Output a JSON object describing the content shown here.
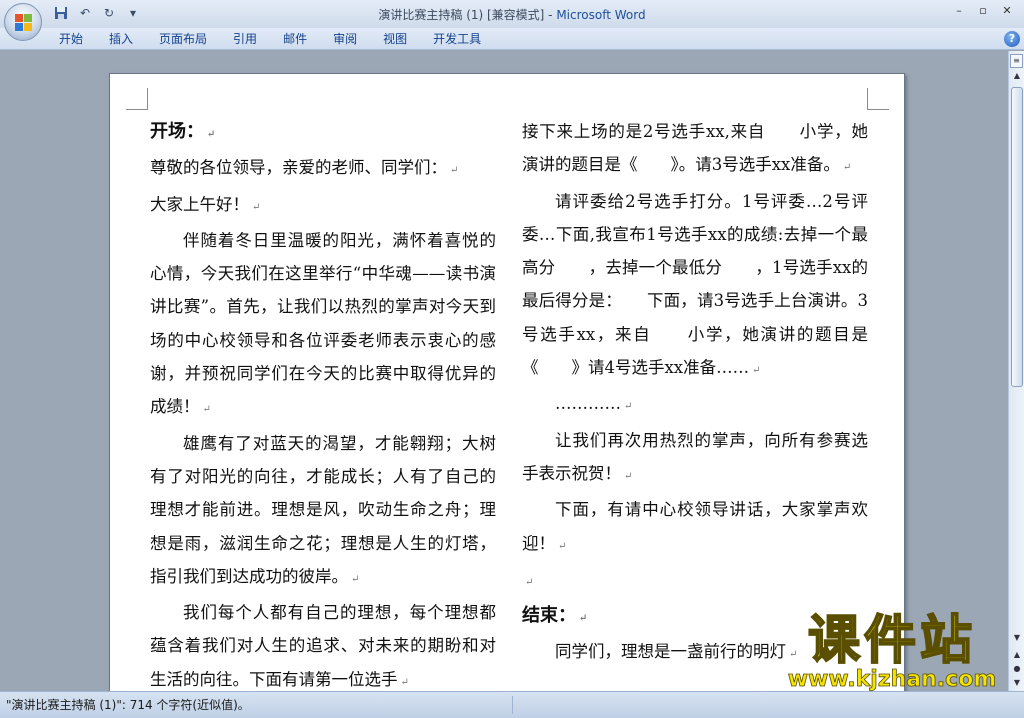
{
  "window": {
    "title_doc": "演讲比赛主持稿 (1) [兼容模式] - ",
    "title_app": "Microsoft Word"
  },
  "quick_access": {
    "save_icon": "save-icon",
    "undo_icon": "undo-icon",
    "redo_icon": "redo-icon",
    "customize_icon": "dropdown-icon"
  },
  "window_controls": {
    "minimize": "–",
    "restore": "▫",
    "close": "✕"
  },
  "ribbon": {
    "tabs": [
      "开始",
      "插入",
      "页面布局",
      "引用",
      "邮件",
      "审阅",
      "视图",
      "开发工具"
    ],
    "help": "?"
  },
  "document": {
    "left_column": [
      {
        "style": "head",
        "text": "开场："
      },
      {
        "style": "plain",
        "text": "尊敬的各位领导，亲爱的老师、同学们："
      },
      {
        "style": "plain",
        "text": "大家上午好！"
      },
      {
        "style": "indent",
        "text": "伴随着冬日里温暖的阳光，满怀着喜悦的心情，今天我们在这里举行“中华魂——读书演讲比赛”。首先，让我们以热烈的掌声对今天到场的中心校领导和各位评委老师表示衷心的感谢，并预祝同学们在今天的比赛中取得优异的成绩！"
      },
      {
        "style": "indent",
        "text": "雄鹰有了对蓝天的渴望，才能翱翔；大树有了对阳光的向往，才能成长；人有了自己的理想才能前进。理想是风，吹动生命之舟；理想是雨，滋润生命之花；理想是人生的灯塔，指引我们到达成功的彼岸。"
      },
      {
        "style": "indent",
        "text": "我们每个人都有自己的理想，每个理想都蕴含着我们对人生的追求、对未来的期盼和对生活的向往。下面有请第一位选手"
      }
    ],
    "right_column": [
      {
        "style": "plain",
        "text": "接下来上场的是2号选手xx,来自　　小学，她演讲的题目是《　　》。请3号选手xx准备。"
      },
      {
        "style": "indent",
        "text": "请评委给2号选手打分。1号评委…2号评委…下面,我宣布1号选手xx的成绩:去掉一个最高分　　，去掉一个最低分　　，1号选手xx的最后得分是：　　下面，请3号选手上台演讲。3号选手xx，来自　　小学，她演讲的题目是《　　》请4号选手xx准备……"
      },
      {
        "style": "indent",
        "text": "…………"
      },
      {
        "style": "indent",
        "text": "让我们再次用热烈的掌声，向所有参赛选手表示祝贺！"
      },
      {
        "style": "indent",
        "text": "下面，有请中心校领导讲话，大家掌声欢迎！"
      },
      {
        "style": "plain",
        "text": ""
      },
      {
        "style": "head",
        "text": "结束："
      },
      {
        "style": "indent",
        "text": "同学们，理想是一盏前行的明灯"
      }
    ]
  },
  "scrollbar": {
    "ruler_icon": "ruler-icon",
    "up": "▲",
    "down": "▼",
    "prev": "▲",
    "browse": "●",
    "next": "▼"
  },
  "status": {
    "text": "\"演讲比赛主持稿 (1)\": 714 个字符(近似值)。"
  },
  "watermark": {
    "main": "课件站",
    "url": "www.kjzhan.com"
  }
}
